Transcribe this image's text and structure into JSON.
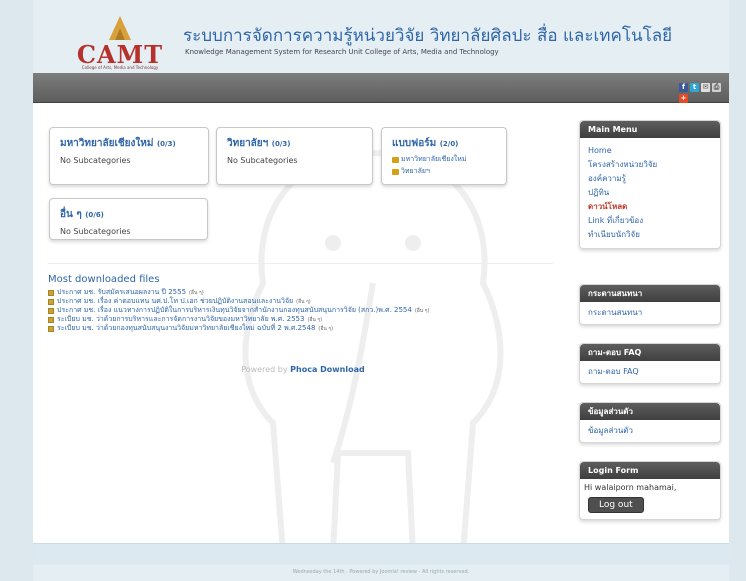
{
  "header": {
    "logo_text": "CAMT",
    "logo_sub": "College of Arts, Media and Technology",
    "title": "ระบบการจัดการความรู้หน่วยวิจัย วิทยาลัยศิลปะ สื่อ และเทคโนโลยี",
    "subtitle": "Knowledge Management System for Research Unit College of Arts, Media and Technology"
  },
  "share": {
    "facebook": "f",
    "twitter": "t",
    "mail": "✉",
    "print": "⎙",
    "plus": "+"
  },
  "categories": [
    {
      "title": "มหาวิทยาลัยเชียงใหม่",
      "count": "(0/3)",
      "sub": "No Subcategories"
    },
    {
      "title": "วิทยาลัยฯ",
      "count": "(0/3)",
      "sub": "No Subcategories"
    },
    {
      "title": "แบบฟอร์ม",
      "count": "(2/0)",
      "links": [
        "มหาวิทยาลัยเชียงใหม่",
        "วิทยาลัยฯ"
      ]
    },
    {
      "title": "อื่น ๆ",
      "count": "(0/6)",
      "sub": "No Subcategories"
    }
  ],
  "most_downloaded": {
    "title": "Most downloaded files",
    "items": [
      {
        "text": "ประกาศ มช. รับสมัครเสนอผลงาน ปี 2555",
        "tag": "(อื่น ๆ)"
      },
      {
        "text": "ประกาศ มช. เรื่อง ค่าตอบแทน นศ.ป.โท ป.เอก ช่วยปฏิบัติงานสอนและงานวิจัย",
        "tag": "(อื่น ๆ)"
      },
      {
        "text": "ประกาศ มช. เรื่อง แนวทางการปฏิบัติในการบริหารเงินทุนวิจัยจากสำนักงานกองทุนสนับสนุนการวิจัย (สกว.)พ.ศ. 2554",
        "tag": "(อื่น ๆ)"
      },
      {
        "text": "ระเบียบ มช. ว่าด้วยการบริหารและการจัดการงานวิจัยของมหาวิทยาลัย พ.ศ. 2553",
        "tag": "(อื่น ๆ)"
      },
      {
        "text": "ระเบียบ มช. ว่าด้วยกองทุนสนับสนุนงานวิจัยมหาวิทยาลัยเชียงใหม่ ฉบับที่ 2 พ.ศ.2548",
        "tag": "(อื่น ๆ)"
      }
    ],
    "powered_prefix": "Powered by",
    "powered_link": "Phoca Download"
  },
  "sidebar": {
    "main_menu": {
      "title": "Main Menu",
      "items": [
        "Home",
        "โครงสร้างหน่วยวิจัย",
        "องค์ความรู้",
        "ปฏิทิน",
        "ดาวน์โหลด",
        "Link ที่เกี่ยวข้อง",
        "ทำเนียบนักวิจัย"
      ],
      "active_index": 4
    },
    "board": {
      "title": "กระดานสนทนา",
      "item": "กระดานสนทนา"
    },
    "faq": {
      "title": "ถาม-ตอบ FAQ",
      "item": "ถาม-ตอบ FAQ"
    },
    "personal": {
      "title": "ข้อมูลส่วนตัว",
      "item": "ข้อมูลส่วนตัว"
    },
    "login": {
      "title": "Login Form",
      "greeting": "Hi walaiporn mahamai,",
      "logout": "Log out"
    }
  },
  "footer": {
    "text": "Wednesday the 14th . Powered by Joomla! review - All rights reserved."
  },
  "colors": {
    "link": "#2f66a8",
    "active": "#c0392b",
    "logo": "#b7312c",
    "header_bar": "#5d5d5d"
  }
}
